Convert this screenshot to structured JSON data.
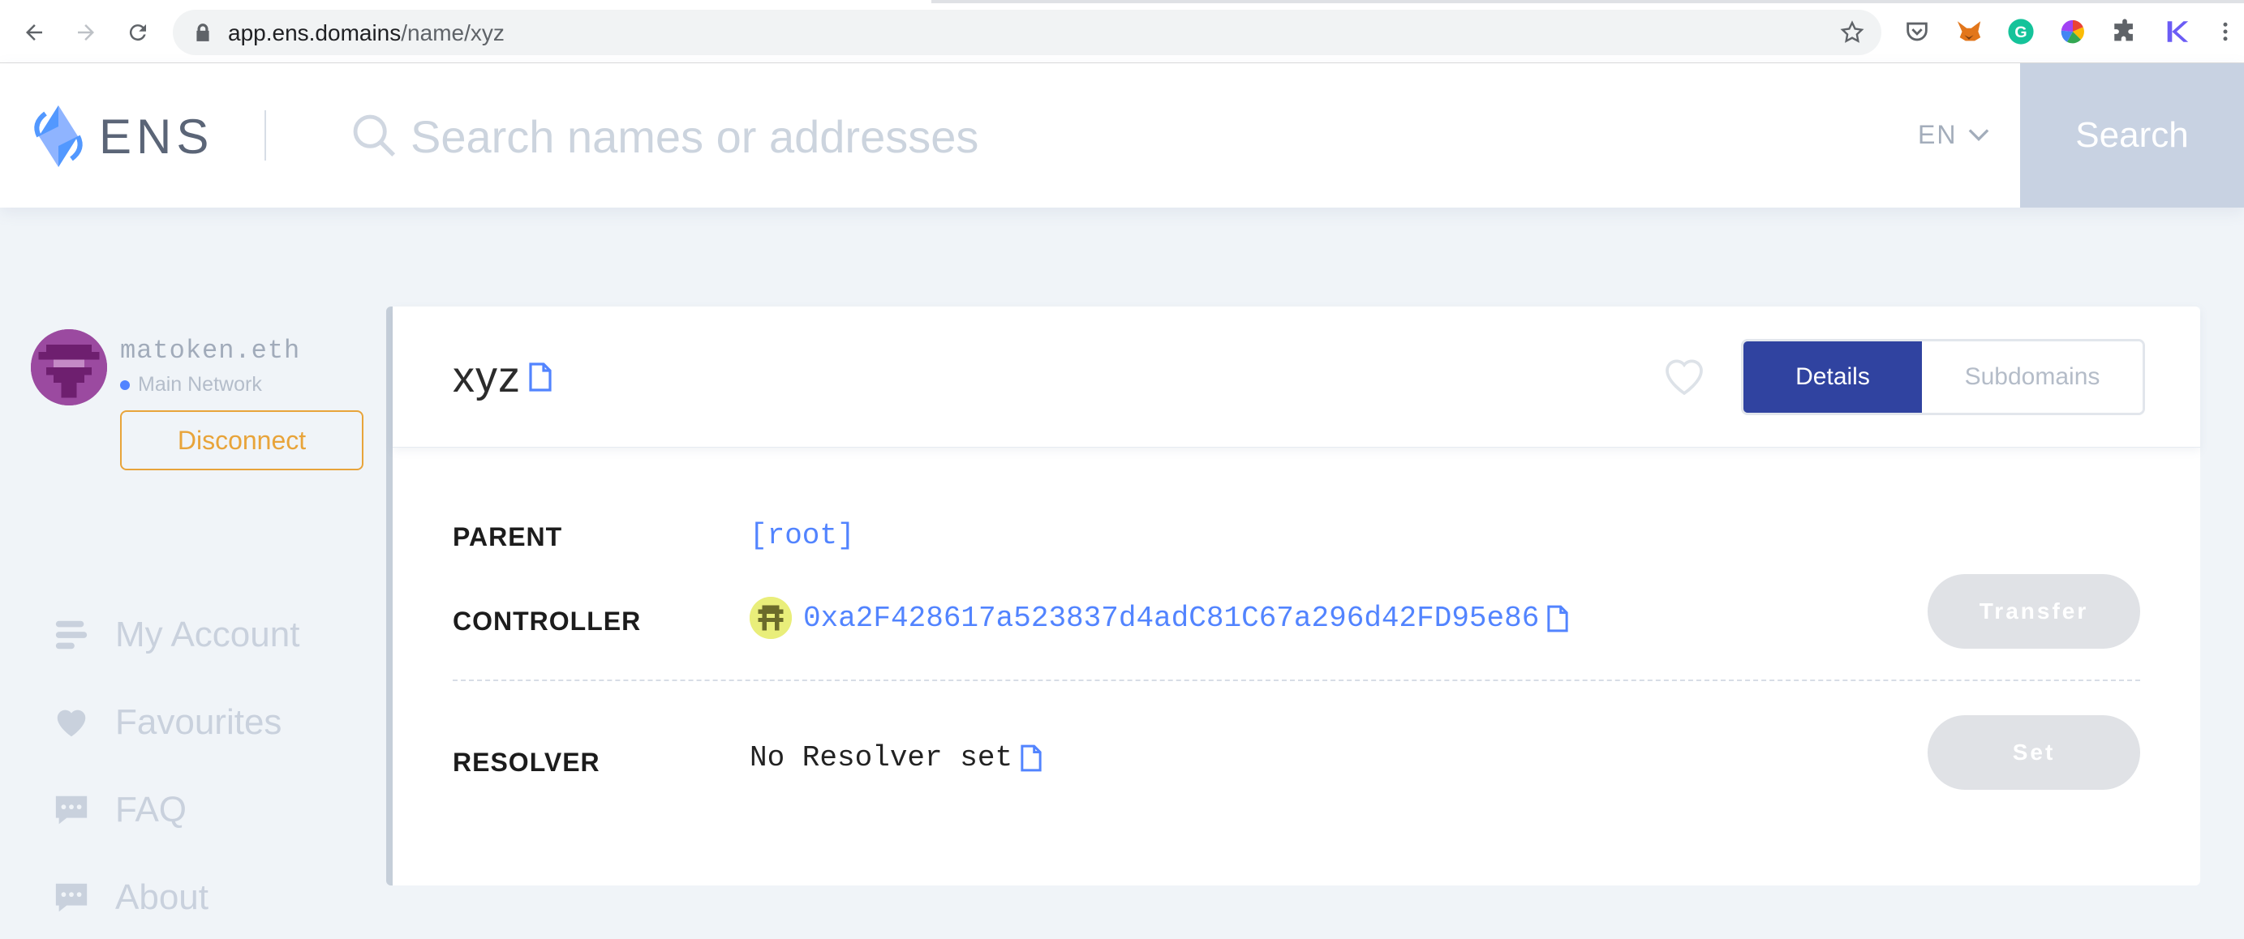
{
  "browser": {
    "url_host": "app.ens.domains",
    "url_path": "/name/xyz"
  },
  "header": {
    "logo_text": "ENS",
    "search_placeholder": "Search names or addresses",
    "language": "EN",
    "search_button": "Search"
  },
  "account": {
    "name": "matoken.eth",
    "network": "Main Network",
    "disconnect_label": "Disconnect"
  },
  "sidebar": {
    "items": [
      {
        "label": "My Account",
        "icon": "list-icon"
      },
      {
        "label": "Favourites",
        "icon": "heart-icon"
      },
      {
        "label": "FAQ",
        "icon": "chat-icon"
      },
      {
        "label": "About",
        "icon": "chat-icon"
      }
    ]
  },
  "domain": {
    "name": "xyz",
    "tabs": {
      "details": "Details",
      "subdomains": "Subdomains"
    },
    "parent": {
      "label": "PARENT",
      "value": "[root]"
    },
    "controller": {
      "label": "CONTROLLER",
      "value": "0xa2F428617a523837d4adC81C67a296d42FD95e86",
      "action": "Transfer"
    },
    "resolver": {
      "label": "RESOLVER",
      "value": "No Resolver set",
      "action": "Set"
    }
  },
  "colors": {
    "accent": "#3043a0",
    "link": "#5284ff",
    "disconnect": "#e8a43a",
    "search_button": "#c8d2e2"
  }
}
